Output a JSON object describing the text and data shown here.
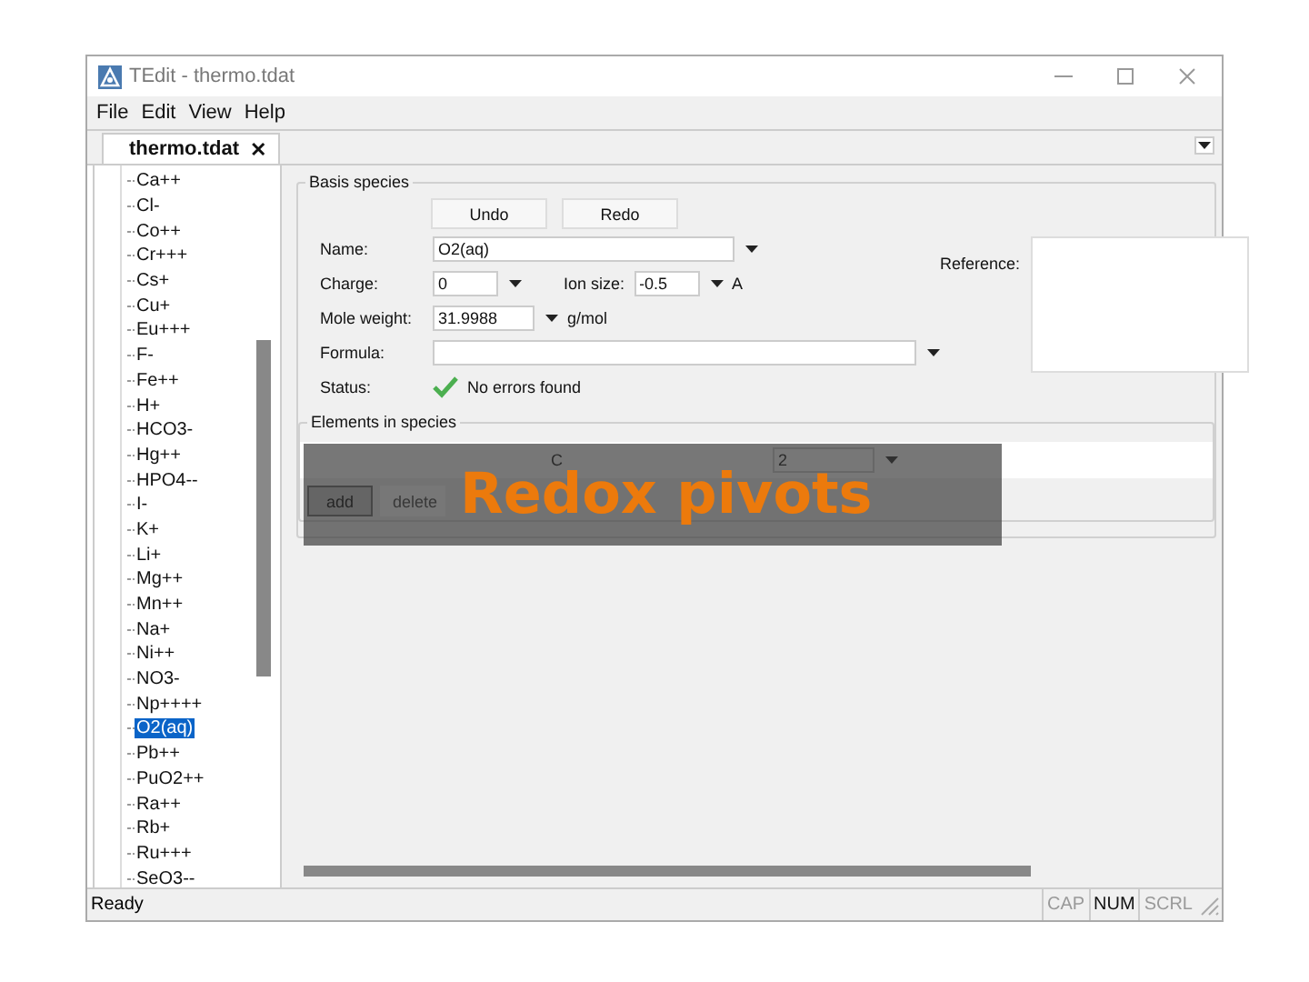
{
  "window": {
    "title": "TEdit - thermo.tdat"
  },
  "menu": [
    "File",
    "Edit",
    "View",
    "Help"
  ],
  "tabs": [
    {
      "label": "thermo.tdat",
      "close": "✕",
      "selected": true
    }
  ],
  "species_list": [
    {
      "label": "Ca++",
      "selected": false
    },
    {
      "label": "Cl-",
      "selected": false
    },
    {
      "label": "Co++",
      "selected": false
    },
    {
      "label": "Cr+++",
      "selected": false
    },
    {
      "label": "Cs+",
      "selected": false
    },
    {
      "label": "Cu+",
      "selected": false
    },
    {
      "label": "Eu+++",
      "selected": false
    },
    {
      "label": "F-",
      "selected": false
    },
    {
      "label": "Fe++",
      "selected": false
    },
    {
      "label": "H+",
      "selected": false
    },
    {
      "label": "HCO3-",
      "selected": false
    },
    {
      "label": "Hg++",
      "selected": false
    },
    {
      "label": "HPO4--",
      "selected": false
    },
    {
      "label": "I-",
      "selected": false
    },
    {
      "label": "K+",
      "selected": false
    },
    {
      "label": "Li+",
      "selected": false
    },
    {
      "label": "Mg++",
      "selected": false
    },
    {
      "label": "Mn++",
      "selected": false
    },
    {
      "label": "Na+",
      "selected": false
    },
    {
      "label": "Ni++",
      "selected": false
    },
    {
      "label": "NO3-",
      "selected": false
    },
    {
      "label": "Np++++",
      "selected": false
    },
    {
      "label": "O2(aq)",
      "selected": true
    },
    {
      "label": "Pb++",
      "selected": false
    },
    {
      "label": "PuO2++",
      "selected": false
    },
    {
      "label": "Ra++",
      "selected": false
    },
    {
      "label": "Rb+",
      "selected": false
    },
    {
      "label": "Ru+++",
      "selected": false
    },
    {
      "label": "SeO3--",
      "selected": false
    }
  ],
  "basis_species": {
    "title": "Basis species",
    "buttons": [
      "Undo",
      "Redo"
    ],
    "name": {
      "label": "Name:",
      "value": "O2(aq)"
    },
    "charge": {
      "label": "Charge:",
      "value": "0"
    },
    "ion_size": {
      "label": "Ion size:",
      "value": "-0.5",
      "unit": "A"
    },
    "mole_weight": {
      "label": "Mole weight:",
      "value": "31.9988",
      "unit": "g/mol"
    },
    "formula": {
      "label": "Formula:"
    },
    "status": {
      "label": "Status:",
      "text": "No errors found",
      "ok": true
    },
    "reference": {
      "label": "Reference:"
    },
    "elements": {
      "title": "Elements in species",
      "rows": [
        {
          "element": "C",
          "count": "2"
        }
      ],
      "buttons": [
        {
          "label": "add",
          "disabled": false
        },
        {
          "label": "delete",
          "disabled": true
        }
      ]
    }
  },
  "overlay": {
    "text": "Redox pivots"
  },
  "status_bar": {
    "text": "Ready",
    "indicators": [
      {
        "label": "CAP",
        "on": false
      },
      {
        "label": "NUM",
        "on": true
      },
      {
        "label": "SCRL",
        "on": false
      }
    ]
  }
}
